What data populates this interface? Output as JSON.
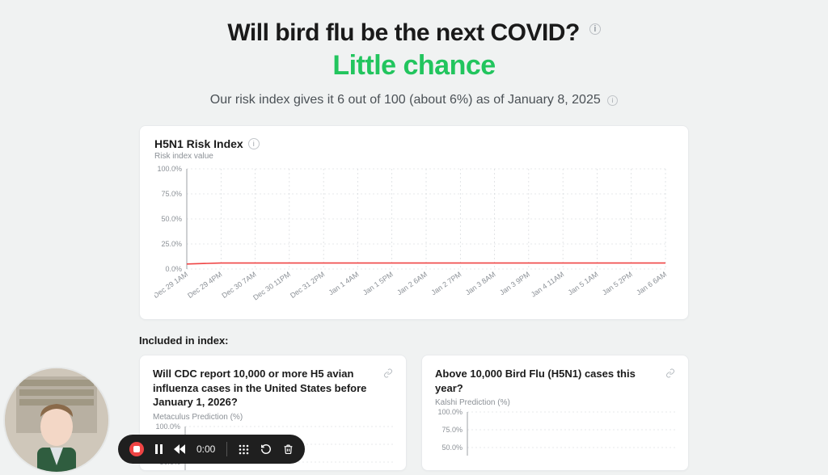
{
  "header": {
    "title": "Will bird flu be the next COVID?",
    "verdict": "Little chance",
    "subline": "Our risk index gives it 6 out of 100 (about 6%) as of January 8, 2025"
  },
  "main_card": {
    "title": "H5N1 Risk Index",
    "subtitle": "Risk index value"
  },
  "section_label": "Included in index:",
  "sub_cards": [
    {
      "title": "Will CDC report 10,000 or more H5 avian influenza cases in the United States before January 1, 2026?",
      "subtitle": "Metaculus Prediction (%)"
    },
    {
      "title": "Above 10,000 Bird Flu (H5N1) cases this year?",
      "subtitle": "Kalshi Prediction (%)"
    }
  ],
  "recorder": {
    "time": "0:00"
  },
  "chart_data": {
    "type": "line",
    "title": "H5N1 Risk Index",
    "ylabel": "Risk index value",
    "ylim": [
      0,
      100
    ],
    "yticks": [
      0,
      25,
      50,
      75,
      100
    ],
    "ytick_labels": [
      "0.0%",
      "25.0%",
      "50.0%",
      "75.0%",
      "100.0%"
    ],
    "categories": [
      "Dec 29 1AM",
      "Dec 29 4PM",
      "Dec 30 7AM",
      "Dec 30 11PM",
      "Dec 31 2PM",
      "Jan 1 4AM",
      "Jan 1 5PM",
      "Jan 2 6AM",
      "Jan 2 7PM",
      "Jan 3 8AM",
      "Jan 3 9PM",
      "Jan 4 11AM",
      "Jan 5 1AM",
      "Jan 5 2PM",
      "Jan 6 6AM"
    ],
    "values": [
      5,
      6,
      6,
      6,
      6,
      6,
      6,
      6,
      6,
      6,
      6,
      6,
      6,
      6,
      6
    ]
  },
  "sub_chart_ylabels": [
    "100.0%",
    "75.0%",
    "50.0%"
  ]
}
